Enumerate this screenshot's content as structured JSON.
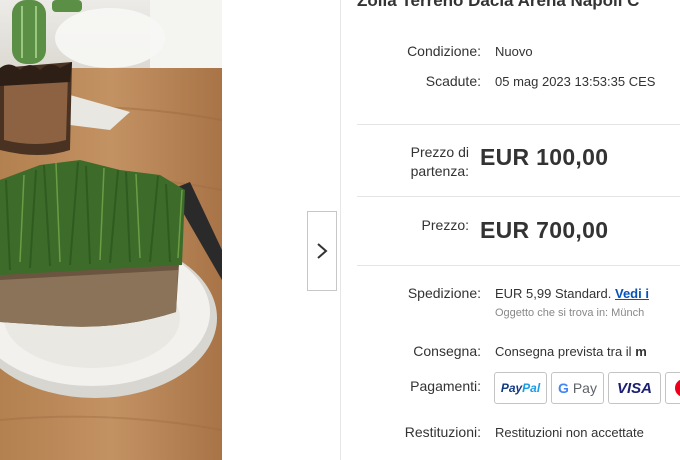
{
  "listing": {
    "title": "Zolla Terreno Dacia Arena Napoli C",
    "condition_label": "Condizione:",
    "condition_value": "Nuovo",
    "ends_label": "Scadute:",
    "ends_value": "05 mag 2023 13:53:35 CES",
    "starting_price_label_line1": "Prezzo di",
    "starting_price_label_line2": "partenza:",
    "starting_price": "EUR 100,00",
    "price_label": "Prezzo:",
    "price": "EUR 700,00",
    "shipping_label": "Spedizione:",
    "shipping_value": "EUR 5,99 Standard.",
    "shipping_link": "Vedi i",
    "shipping_note": "Oggetto che si trova in: Münch",
    "delivery_label": "Consegna:",
    "delivery_value": "Consegna prevista tra il",
    "delivery_value_bold": "m",
    "payments_label": "Pagamenti:",
    "returns_label": "Restituzioni:",
    "returns_value": "Restituzioni non accettate"
  },
  "payments": {
    "paypal_part1": "Pay",
    "paypal_part2": "Pal",
    "gpay_g": "G",
    "gpay_text": "Pay",
    "visa": "VISA",
    "mastercard_color_red": "#eb001b",
    "mastercard_color_yellow": "#f79e1b"
  },
  "gallery": {
    "next_icon": "chevron-right-icon"
  },
  "colors": {
    "link": "#0654ba",
    "text": "#333333"
  }
}
